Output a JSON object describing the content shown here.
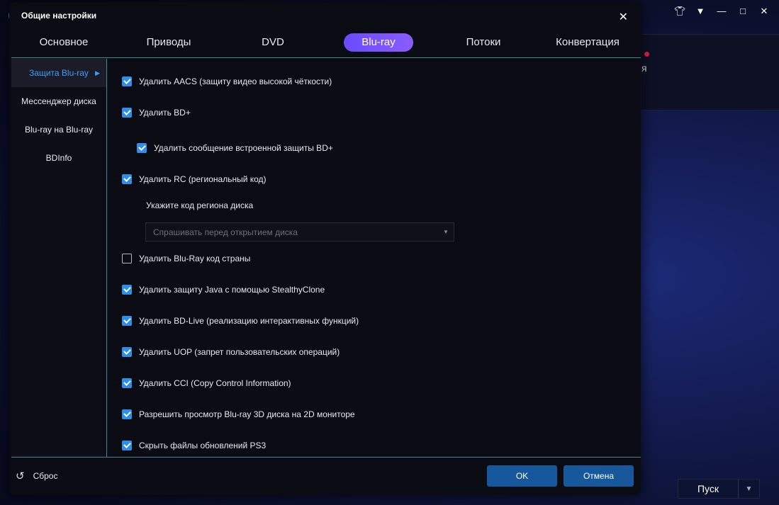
{
  "dialog": {
    "title": "Общие настройки",
    "close_icon": "close-icon"
  },
  "tabs": [
    {
      "label": "Основное"
    },
    {
      "label": "Приводы"
    },
    {
      "label": "DVD"
    },
    {
      "label": "Blu-ray",
      "active": true
    },
    {
      "label": "Потоки"
    },
    {
      "label": "Конвертация"
    }
  ],
  "sidebar": {
    "items": [
      {
        "label": "Защита Blu-ray",
        "active": true
      },
      {
        "label": "Мессенджер диска"
      },
      {
        "label": "Blu-ray на Blu-ray"
      },
      {
        "label": "BDInfo"
      }
    ]
  },
  "options": [
    {
      "label": "Удалить AACS (защиту видео высокой чёткости)",
      "checked": true
    },
    {
      "label": "Удалить BD+",
      "checked": true
    },
    {
      "label": "Удалить сообщение встроенной защиты BD+",
      "checked": true
    },
    {
      "label": "Удалить RC (региональный код)",
      "checked": true
    },
    {
      "label": "Удалить Blu-Ray код страны",
      "checked": false
    },
    {
      "label": "Удалить защиту Java с помощью StealthyClone",
      "checked": true
    },
    {
      "label": "Удалить BD-Live (реализацию интерактивных функций)",
      "checked": true
    },
    {
      "label": "Удалить UOP (запрет пользовательских операций)",
      "checked": true
    },
    {
      "label": "Удалить CCI (Copy Control Information)",
      "checked": true
    },
    {
      "label": "Разрешить просмотр Blu-ray 3D диска на 2D мониторе",
      "checked": true
    },
    {
      "label": "Скрыть файлы обновлений PS3",
      "checked": true
    }
  ],
  "region": {
    "label": "Укажите код региона диска",
    "selected": "Спрашивать перед открытием диска"
  },
  "footer": {
    "reset_label": "Сброс",
    "ok_label": "OK",
    "cancel_label": "Отмена"
  },
  "background": {
    "truncated_text": "я",
    "start_label": "Пуск"
  },
  "colors": {
    "accent": "#2f8fe8",
    "active_tab": "#7a55ff",
    "divider": "#2c8f9b",
    "button": "#17579c"
  }
}
